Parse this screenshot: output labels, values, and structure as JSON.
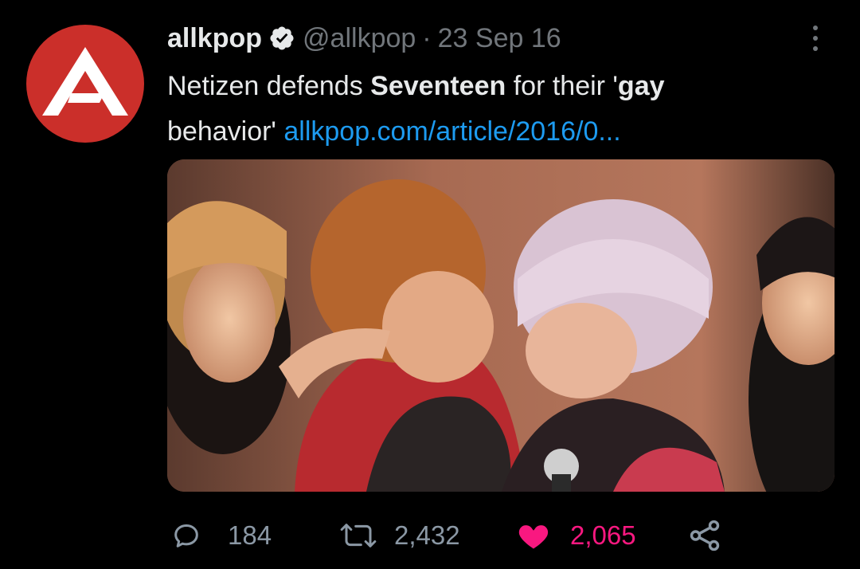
{
  "tweet": {
    "author_name": "allkpop",
    "handle": "@allkpop",
    "separator": "·",
    "date": "23 Sep 16",
    "text_prefix": "Netizen defends ",
    "text_bold_1": "Seventeen",
    "text_middle": " for their '",
    "text_bold_2": "gay",
    "text_line2": "behavior' ",
    "link_text": "allkpop.com/article/2016/0..."
  },
  "media": {
    "kind": "photo"
  },
  "stats": {
    "replies": "184",
    "retweets": "2,432",
    "likes": "2,065"
  },
  "colors": {
    "background": "#000000",
    "text": "#e7e9ea",
    "secondary": "#71767b",
    "link": "#1d9bf0",
    "like": "#f91880",
    "avatar_red": "#cb2f2a"
  },
  "icons": [
    "allkpop-logo-icon",
    "verified-badge-icon",
    "more-options-icon",
    "reply-icon",
    "retweet-icon",
    "like-icon",
    "share-icon"
  ]
}
